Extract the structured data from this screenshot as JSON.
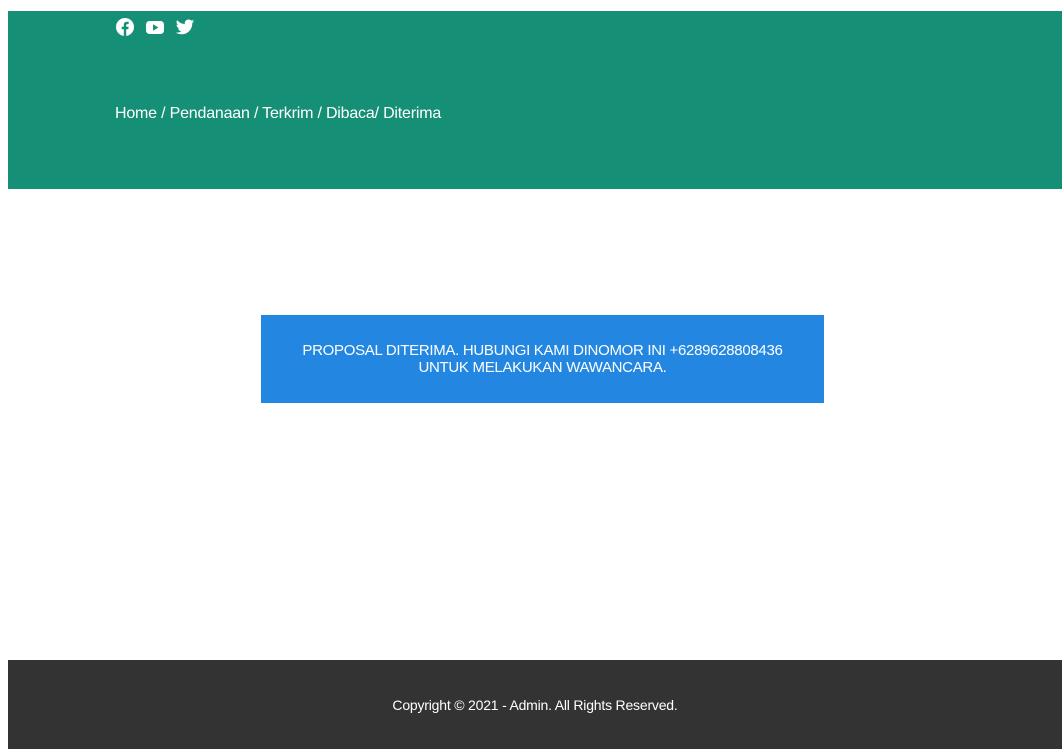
{
  "header": {
    "bg_color": "#158f76",
    "social_icons": [
      "facebook-icon",
      "youtube-icon",
      "twitter-icon"
    ],
    "breadcrumb": {
      "home": "Home",
      "sep1": " / ",
      "pendanaan": "Pendanaan",
      "sep2": " / ",
      "terkrim": "Terkrim",
      "sep3": " / ",
      "dibaca": "Dibaca",
      "sep4": "/ ",
      "diterima": "Diterima"
    }
  },
  "notice": {
    "bg_color": "#2387e1",
    "text": "PROPOSAL DITERIMA. HUBUNGI KAMI DINOMOR INI +6289628808436 UNTUK MELAKUKAN WAWANCARA."
  },
  "footer": {
    "bg_color": "#333333",
    "copyright": "Copyright © 2021 - Admin. All Rights Reserved."
  }
}
